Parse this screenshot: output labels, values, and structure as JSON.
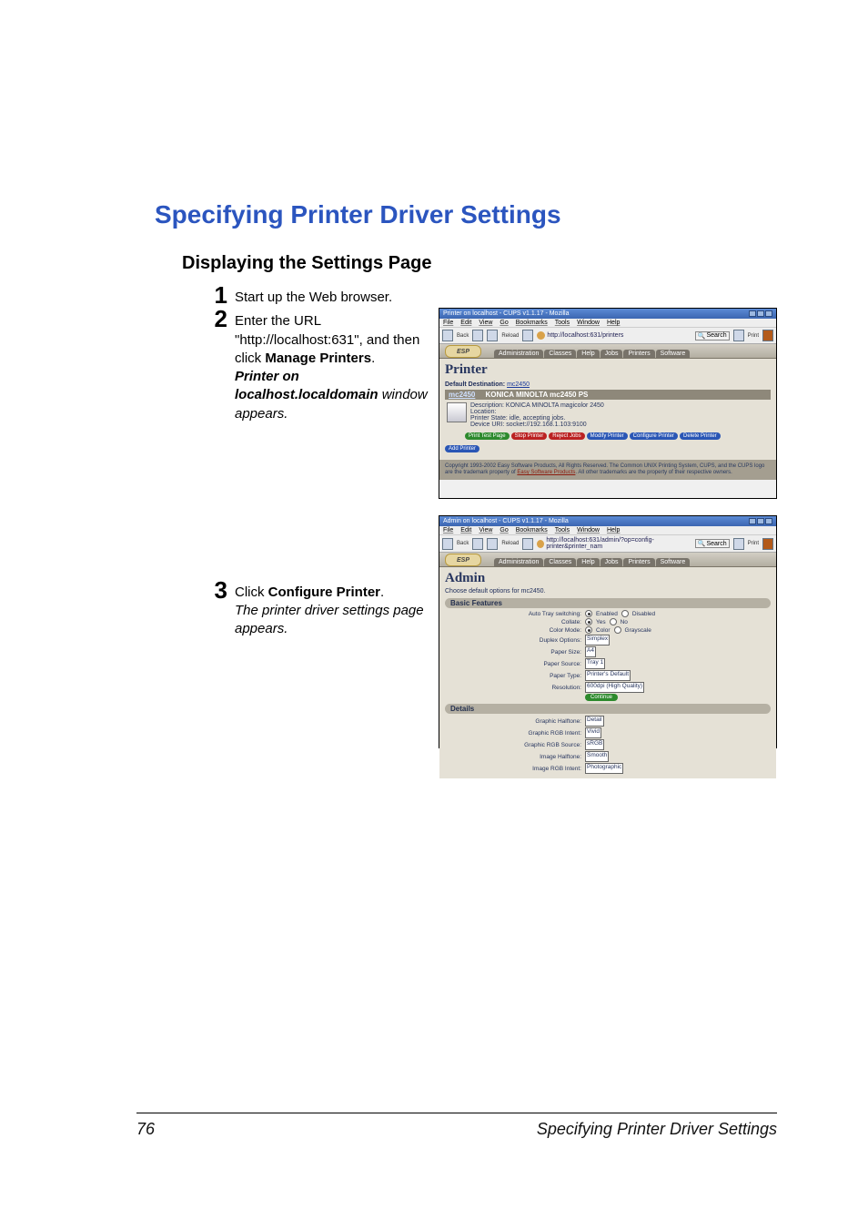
{
  "page": {
    "number": "76",
    "footer_title": "Specifying Printer Driver Settings",
    "section_title": "Specifying Printer Driver Settings",
    "subsection_title": "Displaying the Settings Page"
  },
  "steps": {
    "s1": {
      "num": "1",
      "text": "Start up the Web browser."
    },
    "s2": {
      "num": "2",
      "text_a": "Enter the URL \"http://localhost:631\", and then click ",
      "bold_a": "Manage Printers",
      "text_b": ".",
      "ital_a": "Printer on localhost.localdomain",
      "ital_b": " window appears."
    },
    "s3": {
      "num": "3",
      "text_a": "Click ",
      "bold_a": "Configure Printer",
      "text_b": ".",
      "ital": "The printer driver settings page appears."
    }
  },
  "shot1": {
    "win_title": "Printer on localhost - CUPS v1.1.17 - Mozilla",
    "menu": [
      "File",
      "Edit",
      "View",
      "Go",
      "Bookmarks",
      "Tools",
      "Window",
      "Help"
    ],
    "toolbar": {
      "back": "Back",
      "reload": "Reload",
      "url": "http://localhost:631/printers",
      "search": "Search",
      "print": "Print"
    },
    "esp": "ESP",
    "tabs": [
      "Administration",
      "Classes",
      "Help",
      "Jobs",
      "Printers",
      "Software"
    ],
    "heading": "Printer",
    "default_dest_label": "Default Destination:",
    "default_dest_link": "mc2450",
    "printer_name": "mc2450",
    "printer_title": "KONICA MINOLTA mc2450 PS",
    "desc_label": "Description:",
    "desc_value": "KONICA MINOLTA magicolor 2450",
    "loc_label": "Location:",
    "state_label": "Printer State:",
    "state_value": "idle, accepting jobs.",
    "uri_label": "Device URI:",
    "uri_value": "socket://192.168.1.103:9100",
    "actions": [
      "Print Test Page",
      "Stop Printer",
      "Reject Jobs",
      "Modify Printer",
      "Configure Printer",
      "Delete Printer"
    ],
    "add_printer": "Add Printer",
    "copyright_a": "Copyright 1993-2002 Easy Software Products, All Rights Reserved. The Common UNIX Printing System, CUPS, and the CUPS logo are the trademark property of ",
    "copyright_link": "Easy Software Products",
    "copyright_b": ". All other trademarks are the property of their respective owners."
  },
  "shot2": {
    "win_title": "Admin on localhost - CUPS v1.1.17 - Mozilla",
    "menu": [
      "File",
      "Edit",
      "View",
      "Go",
      "Bookmarks",
      "Tools",
      "Window",
      "Help"
    ],
    "toolbar": {
      "back": "Back",
      "reload": "Reload",
      "url": "http://localhost:631/admin/?op=config-printer&printer_nam",
      "search": "Search",
      "print": "Print"
    },
    "esp": "ESP",
    "tabs": [
      "Administration",
      "Classes",
      "Help",
      "Jobs",
      "Printers",
      "Software"
    ],
    "heading": "Admin",
    "subtext": "Choose default options for mc2450.",
    "group_basic": "Basic Features",
    "opts_basic": {
      "autotray": {
        "label": "Auto Tray switching:",
        "a": "Enabled",
        "b": "Disabled"
      },
      "collate": {
        "label": "Collate:",
        "a": "Yes",
        "b": "No"
      },
      "colormode": {
        "label": "Color Mode:",
        "a": "Color",
        "b": "Grayscale"
      },
      "duplex": {
        "label": "Duplex Options:",
        "value": "Simplex"
      },
      "papersize": {
        "label": "Paper Size:",
        "value": "A4"
      },
      "papersrc": {
        "label": "Paper Source:",
        "value": "Tray 1"
      },
      "papertype": {
        "label": "Paper Type:",
        "value": "Printer's Default"
      },
      "resolution": {
        "label": "Resolution:",
        "value": "600dpi (High Quality)"
      },
      "continue": "Continue"
    },
    "group_details": "Details",
    "opts_details": {
      "g_halftone": {
        "label": "Graphic Halftone:",
        "value": "Detail"
      },
      "g_rgb": {
        "label": "Graphic RGB Intent:",
        "value": "Vivid"
      },
      "g_rgbsrc": {
        "label": "Graphic RGB Source:",
        "value": "sRGB"
      },
      "i_halftone": {
        "label": "Image Halftone:",
        "value": "Smooth"
      },
      "i_rgb": {
        "label": "Image RGB Intent:",
        "value": "Photographic"
      }
    }
  }
}
